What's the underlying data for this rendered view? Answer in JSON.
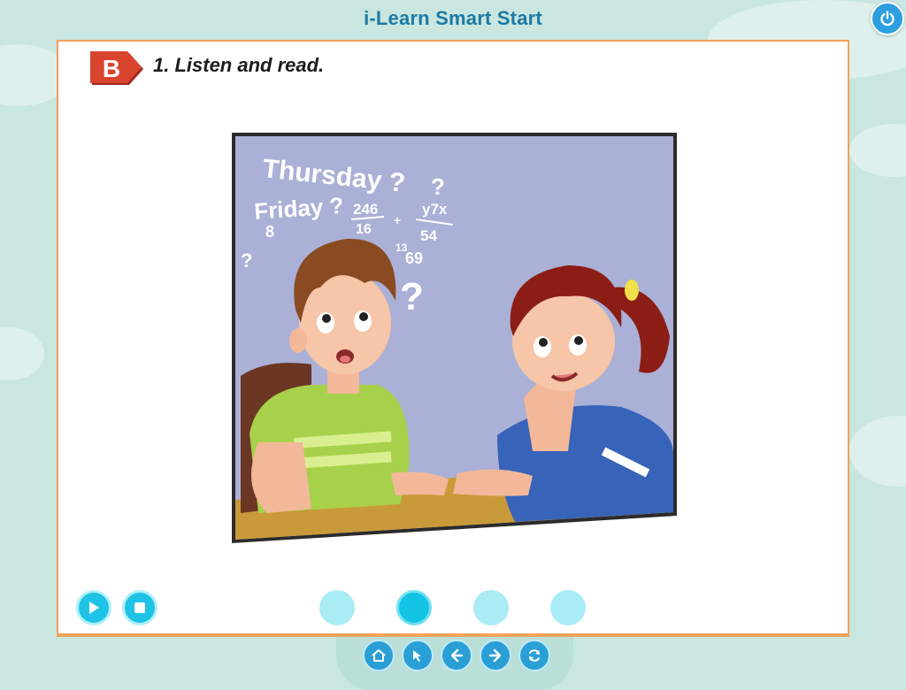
{
  "app": {
    "title": "i-Learn Smart Start"
  },
  "exercise": {
    "section_letter": "B",
    "instruction": "1. Listen and read."
  },
  "illustration": {
    "words": [
      "Thursday ?",
      "?",
      "Friday ?",
      "246",
      "16",
      "8",
      "+",
      "y7x",
      "54",
      "13",
      "69",
      "?",
      "?"
    ]
  },
  "player": {
    "play_icon": "play-icon",
    "stop_icon": "stop-icon"
  },
  "pages": {
    "count": 4,
    "active_index": 1
  },
  "nav": {
    "icons": [
      "home-icon",
      "pointer-icon",
      "back-arrow-icon",
      "forward-arrow-icon",
      "refresh-icon"
    ]
  },
  "colors": {
    "accent": "#1ec3e6",
    "panel_border": "#f0a25a",
    "title": "#1d7aa3",
    "badge": "#d9442f"
  }
}
